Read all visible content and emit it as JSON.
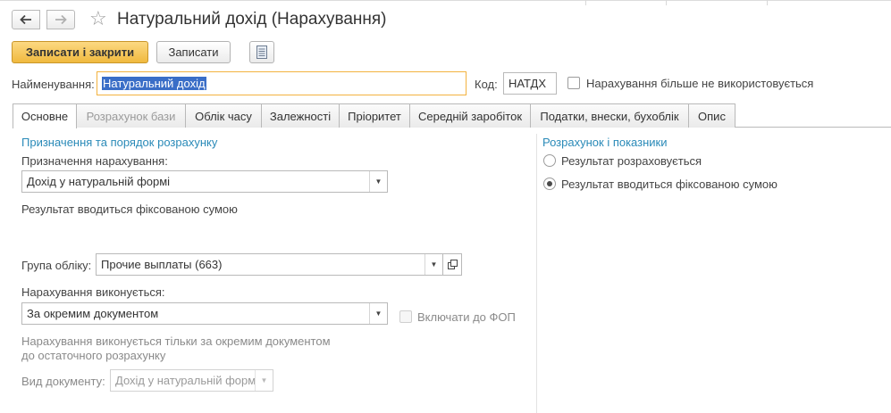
{
  "header": {
    "title": "Натуральний дохід (Нарахування)",
    "back_icon": "arrow-left-icon",
    "forward_icon": "arrow-right-icon",
    "favorite_icon": "star-icon"
  },
  "toolbar": {
    "save_close_label": "Записати і закрити",
    "save_label": "Записати",
    "report_icon": "document-list-icon"
  },
  "name_row": {
    "name_label": "Найменування:",
    "name_value": "Натуральний дохід",
    "code_label": "Код:",
    "code_value": "НАТДХ",
    "unused_label": "Нарахування більше не використовується",
    "unused_checked": false
  },
  "tabs": [
    {
      "label": "Основне",
      "active": true,
      "disabled": false
    },
    {
      "label": "Розрахунок бази",
      "active": false,
      "disabled": true
    },
    {
      "label": "Облік часу",
      "active": false,
      "disabled": false
    },
    {
      "label": "Залежності",
      "active": false,
      "disabled": false
    },
    {
      "label": "Пріоритет",
      "active": false,
      "disabled": false
    },
    {
      "label": "Середній заробіток",
      "active": false,
      "disabled": false
    },
    {
      "label": "Податки, внески, бухоблік",
      "active": false,
      "disabled": false
    },
    {
      "label": "Опис",
      "active": false,
      "disabled": false
    }
  ],
  "left_panel": {
    "section_title": "Призначення та порядок розрахунку",
    "purpose_label": "Призначення нарахування:",
    "purpose_value": "Дохід у натуральній формі",
    "result_note": "Результат вводиться фіксованою сумою",
    "group_label": "Група обліку:",
    "group_value": "Прочие выплаты (663)",
    "executed_label": "Нарахування виконується:",
    "executed_value": "За окремим документом",
    "fop_label": "Включати до ФОП",
    "fop_checked": false,
    "note_line1": "Нарахування виконується тільки за окремим документом",
    "note_line2": "до остаточного розрахунку",
    "doctype_label": "Вид документу:",
    "doctype_value": "Дохід у натуральній формі"
  },
  "right_panel": {
    "section_title": "Розрахунок і показники",
    "options": [
      {
        "label": "Результат розраховується",
        "selected": false
      },
      {
        "label": "Результат вводиться фіксованою сумою",
        "selected": true
      }
    ]
  },
  "colors": {
    "accent_section": "#2a8ab8",
    "primary_button": "#f0b93f",
    "focus_border": "#f3b23f",
    "selection": "#3a6ec7"
  }
}
